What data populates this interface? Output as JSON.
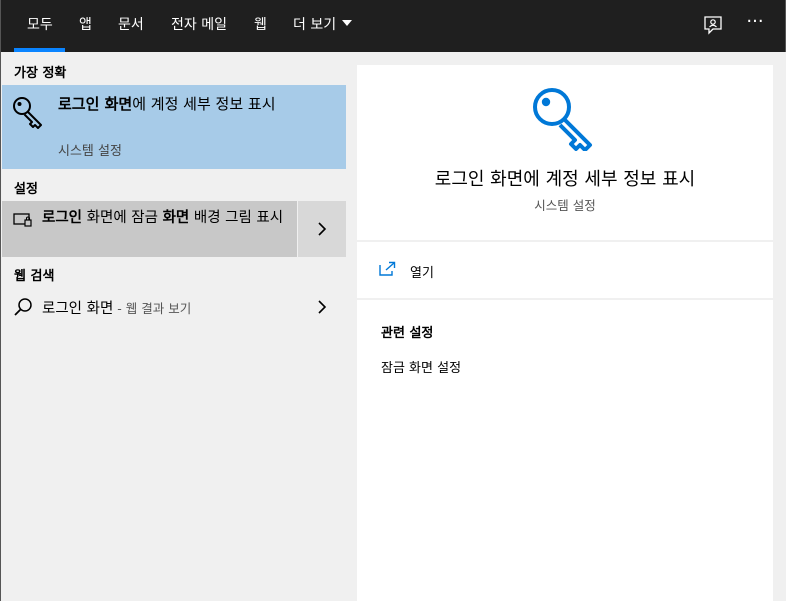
{
  "tabs": [
    {
      "label": "모두",
      "active": true
    },
    {
      "label": "앱"
    },
    {
      "label": "문서"
    },
    {
      "label": "전자 메일"
    },
    {
      "label": "웹"
    },
    {
      "label": "더 보기"
    }
  ],
  "top_icons": {
    "feedback": "feedback-icon",
    "more": "more-options-icon",
    "more_text": "···"
  },
  "left": {
    "best_match_header": "가장 정확",
    "best_match": {
      "title_bold": "로그인 화면",
      "title_rest": "에 계정 세부 정보 표시",
      "subtitle": "시스템 설정",
      "icon": "key-icon"
    },
    "settings_header": "설정",
    "setting_item": {
      "bold1": "로그인",
      "mid1": " 화면에 잠금 ",
      "bold2": "화면",
      "rest": " 배경 그림 표시",
      "icon": "monitor-lock-icon"
    },
    "web_header": "웹 검색",
    "web_item": {
      "query": "로그인 화면",
      "suffix": " - 웹 결과 보기",
      "icon": "search-icon"
    }
  },
  "right": {
    "title": "로그인 화면에 계정 세부 정보 표시",
    "subtitle": "시스템 설정",
    "open_label": "열기",
    "related_header": "관련 설정",
    "related_items": [
      "잠금 화면 설정"
    ]
  },
  "colors": {
    "accent": "#0078d7",
    "selected_bg": "#a7cbe8",
    "topbar_bg": "#1f1f1f",
    "underline": "#0a84ff"
  }
}
